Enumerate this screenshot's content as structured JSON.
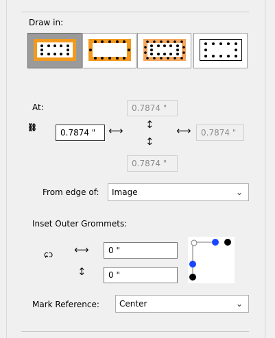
{
  "draw_in": {
    "label": "Draw in:",
    "modes": [
      {
        "icon": "grommets-on-border-icon",
        "selected": true
      },
      {
        "icon": "grommets-inside-border-icon",
        "selected": false
      },
      {
        "icon": "grommets-over-border-icon",
        "selected": false
      },
      {
        "icon": "grommets-no-border-icon",
        "selected": false
      }
    ]
  },
  "at": {
    "label": "At:",
    "top_value": "0.7874 \"",
    "left_value": "0.7874 \"",
    "right_value": "0.7874 \"",
    "bottom_value": "0.7874 \""
  },
  "from_edge": {
    "label": "From edge of:",
    "value": "Image"
  },
  "inset": {
    "label": "Inset Outer Grommets:",
    "horizontal_value": "0 \"",
    "vertical_value": "0 \""
  },
  "mark_reference": {
    "label": "Mark Reference:",
    "value": "Center"
  },
  "colors": {
    "accent_orange": "#f39a1e",
    "selected_bg": "#9a9a9a",
    "blue_dot": "#1a45ff"
  }
}
